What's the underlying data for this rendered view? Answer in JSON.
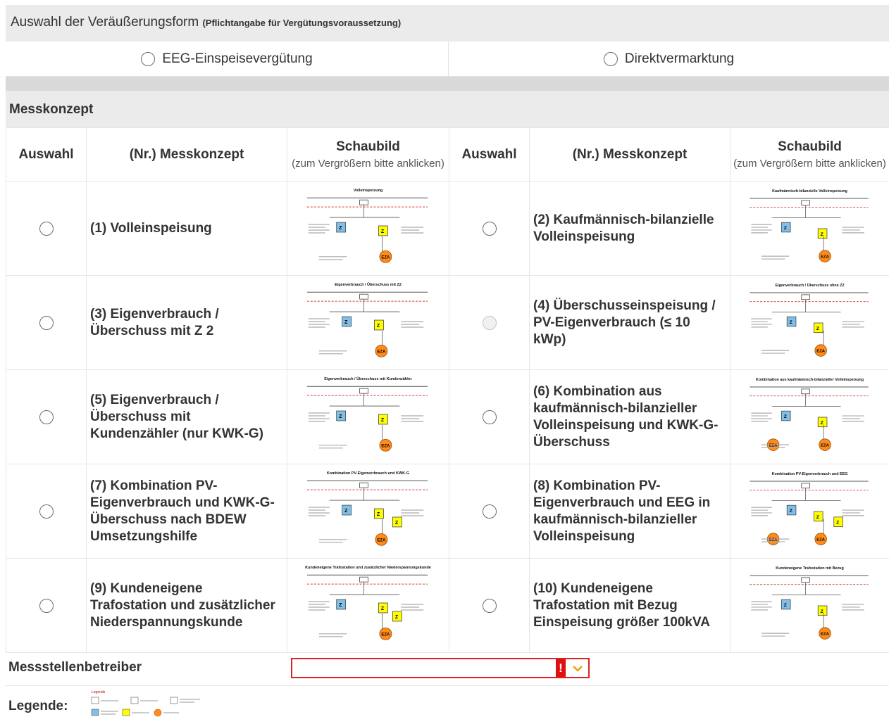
{
  "veraeusserung": {
    "title": "Auswahl der Veräußerungsform",
    "note": "(Pflichtangabe für Vergütungsvoraussetzung)",
    "options": [
      "EEG-Einspeisevergütung",
      "Direktvermarktung"
    ]
  },
  "messkonzept": {
    "title": "Messkonzept",
    "headers": {
      "auswahl": "Auswahl",
      "messkonzept": "(Nr.) Messkonzept",
      "schaubild": "Schaubild",
      "schaubild_hint": "(zum Vergrößern bitte anklicken)"
    },
    "concepts": [
      {
        "label": "(1) Volleinspeisung",
        "diagram_title": "Volleinspeisung",
        "selectable": true
      },
      {
        "label": "(2) Kaufmännisch-bilanzielle Volleinspeisung",
        "diagram_title": "Kaufmännisch-bilanzielle Volleinspeisung",
        "selectable": true
      },
      {
        "label": "(3) Eigenverbrauch / Überschuss mit Z 2",
        "diagram_title": "Eigenverbrauch / Überschuss mit Z2",
        "selectable": true
      },
      {
        "label": "(4) Überschusseinspeisung / PV-Eigenverbrauch (≤ 10 kWp)",
        "diagram_title": "Eigenverbrauch / Überschuss ohne Z2",
        "selectable": false
      },
      {
        "label": "(5) Eigenverbrauch / Überschuss mit Kundenzähler (nur KWK-G)",
        "diagram_title": "Eigenverbrauch / Überschuss mit Kundenzähler",
        "selectable": true
      },
      {
        "label": "(6) Kombination aus kaufmännisch-bilanzieller Volleinspeisung und KWK-G-Überschuss",
        "diagram_title": "Kombination aus kaufmännisch-bilanzieller Volleinspeisung",
        "selectable": true
      },
      {
        "label": "(7) Kombination PV-Eigenverbrauch und KWK-G-Überschuss nach BDEW Umsetzungshilfe",
        "diagram_title": "Kombination PV-Eigenverbrauch und KWK-G",
        "selectable": true
      },
      {
        "label": "(8) Kombination PV-Eigenverbrauch und EEG in kaufmännisch-bilanzieller Volleinspeisung",
        "diagram_title": "Kombination PV-Eigenverbrauch und EEG",
        "selectable": true
      },
      {
        "label": "(9) Kundeneigene Trafostation und zusätzlicher Niederspannungskunde",
        "diagram_title": "Kundeneigene Trafostation und zusätzlicher Niederspannungskunde",
        "selectable": true
      },
      {
        "label": "(10) Kundeneigene Trafostation mit Bezug Einspeisung größer 100kVA",
        "diagram_title": "Kundeneigene Trafostation mit Bezug",
        "selectable": true
      }
    ]
  },
  "messstellenbetreiber": {
    "label": "Messstellenbetreiber",
    "value": "",
    "warning_icon": "exclamation-icon",
    "caret_icon": "chevron-down-icon"
  },
  "legende": {
    "label": "Legende:",
    "image_title": "Legende"
  },
  "colors": {
    "section_bg": "#ebebeb",
    "meter_blue": "#7fbfe8",
    "meter_yellow": "#ffff00",
    "eza_orange": "#ff8c1a",
    "error_red": "#e01010",
    "caret_orange": "#f0a000"
  }
}
